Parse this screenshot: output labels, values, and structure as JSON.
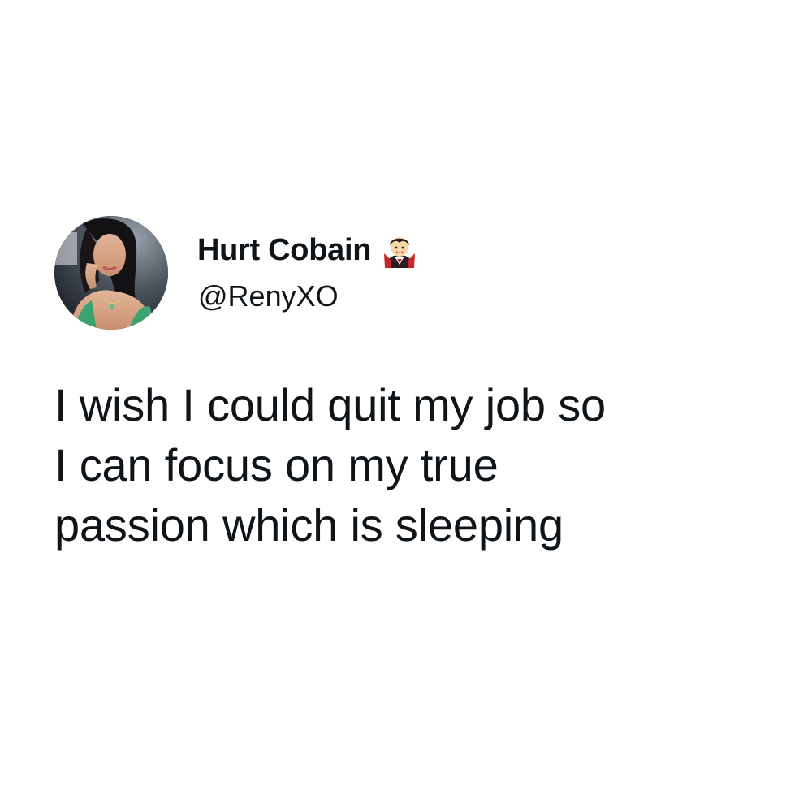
{
  "tweet": {
    "author": {
      "display_name": "Hurt Cobain",
      "handle": "@RenyXO",
      "avatar_icon": "profile-photo-icon",
      "badge_icon": "vampire-emoji-icon"
    },
    "text_lines": [
      "I wish I could quit my job so",
      "I can focus on my true",
      "passion which is sleeping"
    ]
  },
  "colors": {
    "background": "#ffffff",
    "text": "#0f1419",
    "accent": "#3aa36f"
  }
}
